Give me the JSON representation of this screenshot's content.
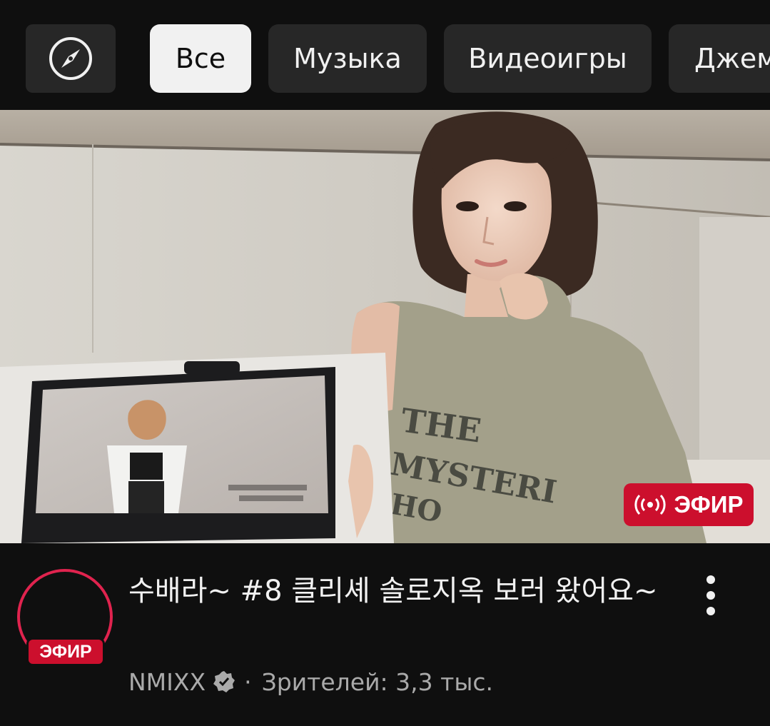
{
  "chips": [
    {
      "label": "Все",
      "active": true
    },
    {
      "label": "Музыка",
      "active": false
    },
    {
      "label": "Видеоигры",
      "active": false
    },
    {
      "label": "Джем",
      "active": false
    }
  ],
  "video": {
    "live_badge": "ЭФИР",
    "title": "수배라~ #8  클리셰 솔로지옥 보러 왔어요~",
    "channel": "NMIXX",
    "separator": "·",
    "viewers": "Зрителей: 3,3 тыс.",
    "avatar_live_label": "ЭФИР",
    "shirt_text": [
      "THE",
      "MYSTERI",
      "HO"
    ]
  },
  "icons": {
    "explore": "compass-icon",
    "live": "live-broadcast-icon",
    "verified": "verified-badge-icon",
    "more": "more-vert-icon"
  },
  "colors": {
    "background": "#0f0f0f",
    "chip": "#272727",
    "chip_active": "#f1f1f1",
    "live_red": "#cc0f2d",
    "meta_text": "#aaaaaa"
  }
}
